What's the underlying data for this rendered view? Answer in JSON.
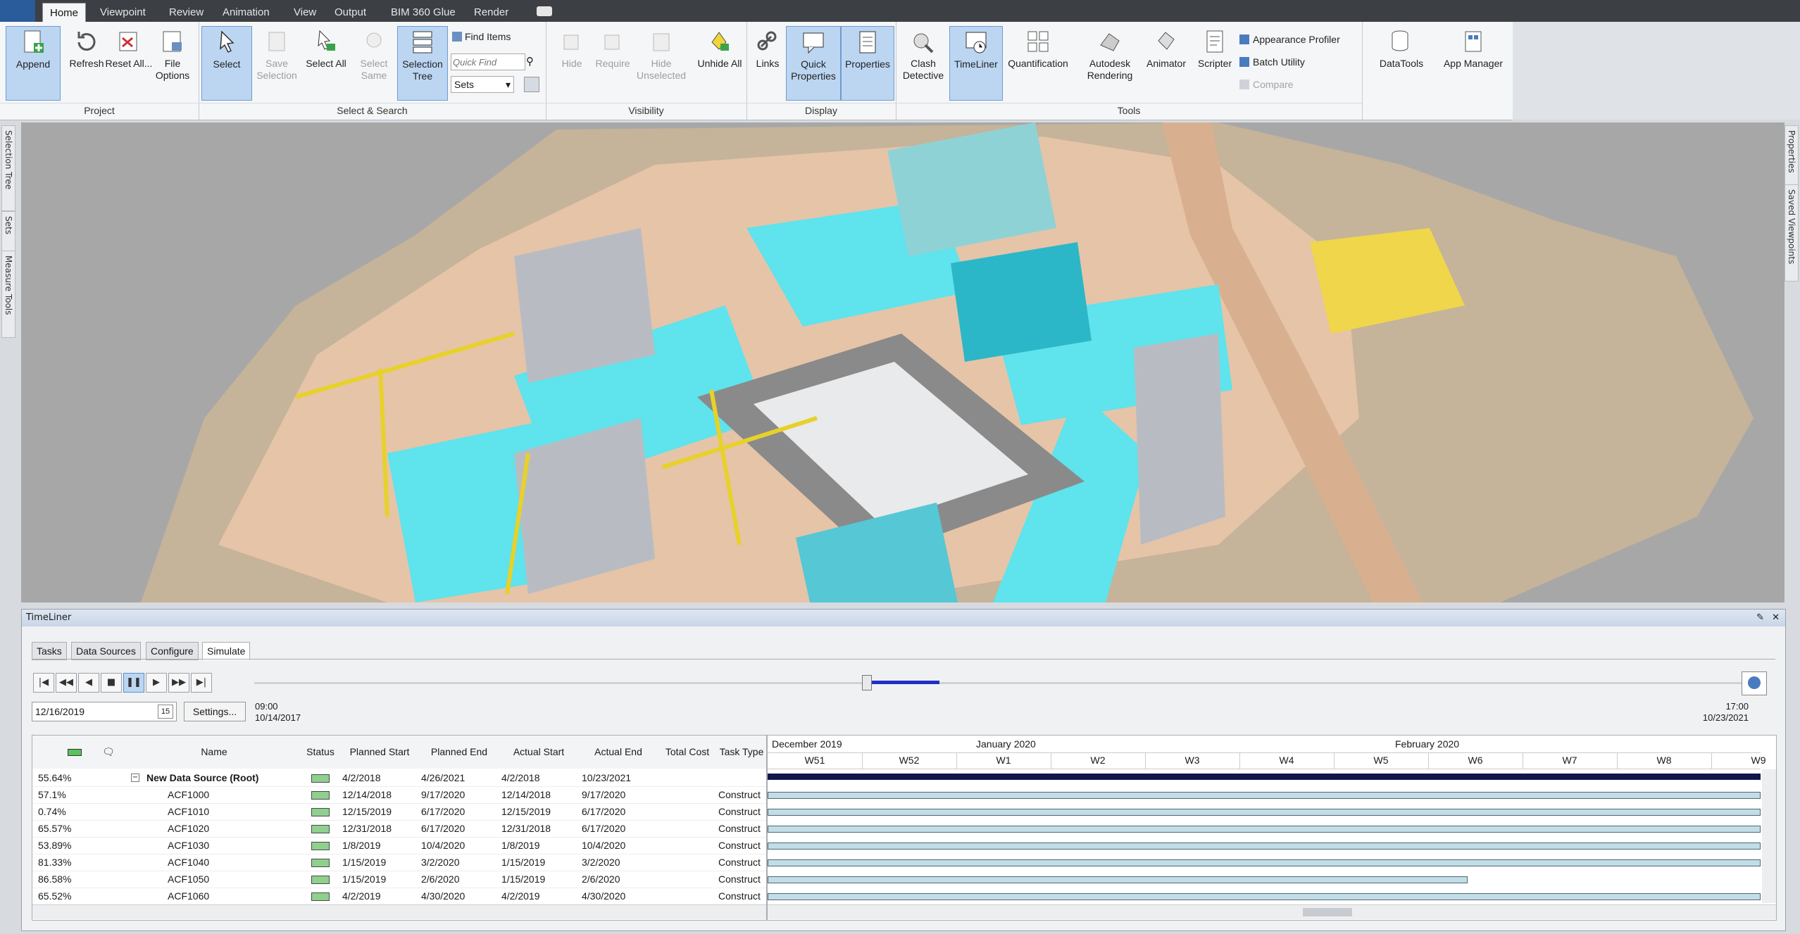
{
  "ribbon_tabs": [
    "Home",
    "Viewpoint",
    "Review",
    "Animation",
    "View",
    "Output",
    "BIM 360 Glue",
    "Render"
  ],
  "active_tab": "Home",
  "panels": {
    "project": {
      "label": "Project",
      "buttons": [
        {
          "label": "Append"
        },
        {
          "label": "Refresh"
        },
        {
          "label": "Reset All..."
        },
        {
          "label": "File Options"
        }
      ]
    },
    "select_search": {
      "label": "Select & Search",
      "buttons": [
        {
          "label": "Select"
        },
        {
          "label": "Save Selection"
        },
        {
          "label": "Select All"
        },
        {
          "label": "Select Same"
        },
        {
          "label": "Selection Tree"
        }
      ],
      "find_items": "Find Items",
      "quick_find_placeholder": "Quick Find",
      "sets_label": "Sets"
    },
    "visibility": {
      "label": "Visibility",
      "buttons": [
        {
          "label": "Hide"
        },
        {
          "label": "Require"
        },
        {
          "label": "Hide Unselected"
        },
        {
          "label": "Unhide All"
        }
      ]
    },
    "display": {
      "label": "Display",
      "buttons": [
        {
          "label": "Links"
        },
        {
          "label": "Quick Properties"
        },
        {
          "label": "Properties"
        }
      ]
    },
    "tools": {
      "label": "Tools",
      "buttons": [
        {
          "label": "Clash Detective"
        },
        {
          "label": "TimeLiner"
        },
        {
          "label": "Quantification"
        },
        {
          "label": "Autodesk Rendering"
        },
        {
          "label": "Animator"
        },
        {
          "label": "Scripter"
        }
      ],
      "small": [
        {
          "label": "Appearance Profiler"
        },
        {
          "label": "Batch Utility"
        },
        {
          "label": "Compare"
        }
      ]
    },
    "extra": {
      "buttons": [
        {
          "label": "DataTools"
        },
        {
          "label": "App Manager"
        }
      ]
    }
  },
  "side_tabs_left": [
    "Selection Tree",
    "Sets",
    "Measure Tools"
  ],
  "side_tabs_right": [
    "Properties",
    "Saved Viewpoints"
  ],
  "timeliner": {
    "title": "TimeLiner",
    "tabs": [
      "Tasks",
      "Data Sources",
      "Configure",
      "Simulate"
    ],
    "active_tab": "Simulate",
    "date_value": "12/16/2019",
    "settings_label": "Settings...",
    "start_time": "09:00",
    "start_date": "10/14/2017",
    "end_time": "17:00",
    "end_date": "10/23/2021",
    "slider_position": 0.41,
    "columns": [
      "Name",
      "Status",
      "Planned Start",
      "Planned End",
      "Actual Start",
      "Actual End",
      "Total Cost",
      "Task Type"
    ],
    "rows": [
      {
        "pct": "55.64%",
        "name": "New Data Source (Root)",
        "ps": "4/2/2018",
        "pe": "4/26/2021",
        "as": "4/2/2018",
        "ae": "10/23/2021",
        "type": "",
        "root": true
      },
      {
        "pct": "57.1%",
        "name": "ACF1000",
        "ps": "12/14/2018",
        "pe": "9/17/2020",
        "as": "12/14/2018",
        "ae": "9/17/2020",
        "type": "Construct"
      },
      {
        "pct": "0.74%",
        "name": "ACF1010",
        "ps": "12/15/2019",
        "pe": "6/17/2020",
        "as": "12/15/2019",
        "ae": "6/17/2020",
        "type": "Construct"
      },
      {
        "pct": "65.57%",
        "name": "ACF1020",
        "ps": "12/31/2018",
        "pe": "6/17/2020",
        "as": "12/31/2018",
        "ae": "6/17/2020",
        "type": "Construct"
      },
      {
        "pct": "53.89%",
        "name": "ACF1030",
        "ps": "1/8/2019",
        "pe": "10/4/2020",
        "as": "1/8/2019",
        "ae": "10/4/2020",
        "type": "Construct"
      },
      {
        "pct": "81.33%",
        "name": "ACF1040",
        "ps": "1/15/2019",
        "pe": "3/2/2020",
        "as": "1/15/2019",
        "ae": "3/2/2020",
        "type": "Construct"
      },
      {
        "pct": "86.58%",
        "name": "ACF1050",
        "ps": "1/15/2019",
        "pe": "2/6/2020",
        "as": "1/15/2019",
        "ae": "2/6/2020",
        "type": "Construct"
      },
      {
        "pct": "65.52%",
        "name": "ACF1060",
        "ps": "4/2/2019",
        "pe": "4/30/2020",
        "as": "4/2/2019",
        "ae": "4/30/2020",
        "type": "Construct"
      }
    ],
    "gantt_months": [
      "December 2019",
      "January 2020",
      "February 2020"
    ],
    "gantt_weeks": [
      "W51",
      "W52",
      "W1",
      "W2",
      "W3",
      "W4",
      "W5",
      "W6",
      "W7",
      "W8",
      "W9"
    ]
  },
  "colors": {
    "accent": "#6d9bd1",
    "cyan": "#5fe3ec",
    "ground": "#c9b49a",
    "road": "#e9c8b0"
  }
}
